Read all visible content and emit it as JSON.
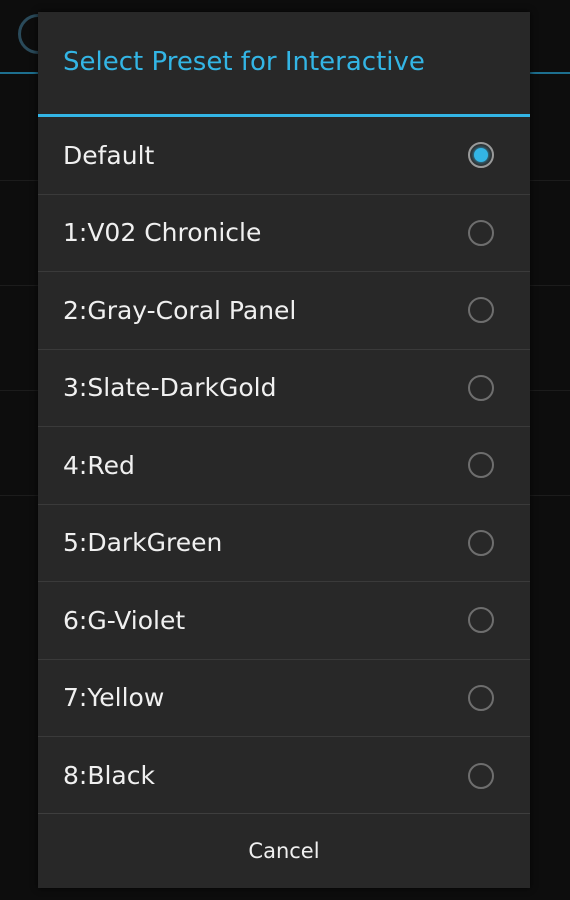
{
  "dialog": {
    "title": "Select Preset for Interactive",
    "accent_color": "#33b5e5",
    "items": [
      {
        "label": "Default",
        "checked": true
      },
      {
        "label": "1:V02 Chronicle",
        "checked": false
      },
      {
        "label": "2:Gray-Coral Panel",
        "checked": false
      },
      {
        "label": "3:Slate-DarkGold",
        "checked": false
      },
      {
        "label": "4:Red",
        "checked": false
      },
      {
        "label": "5:DarkGreen",
        "checked": false
      },
      {
        "label": "6:G-Violet",
        "checked": false
      },
      {
        "label": "7:Yellow",
        "checked": false
      },
      {
        "label": "8:Black",
        "checked": false
      }
    ],
    "cancel_label": "Cancel"
  }
}
